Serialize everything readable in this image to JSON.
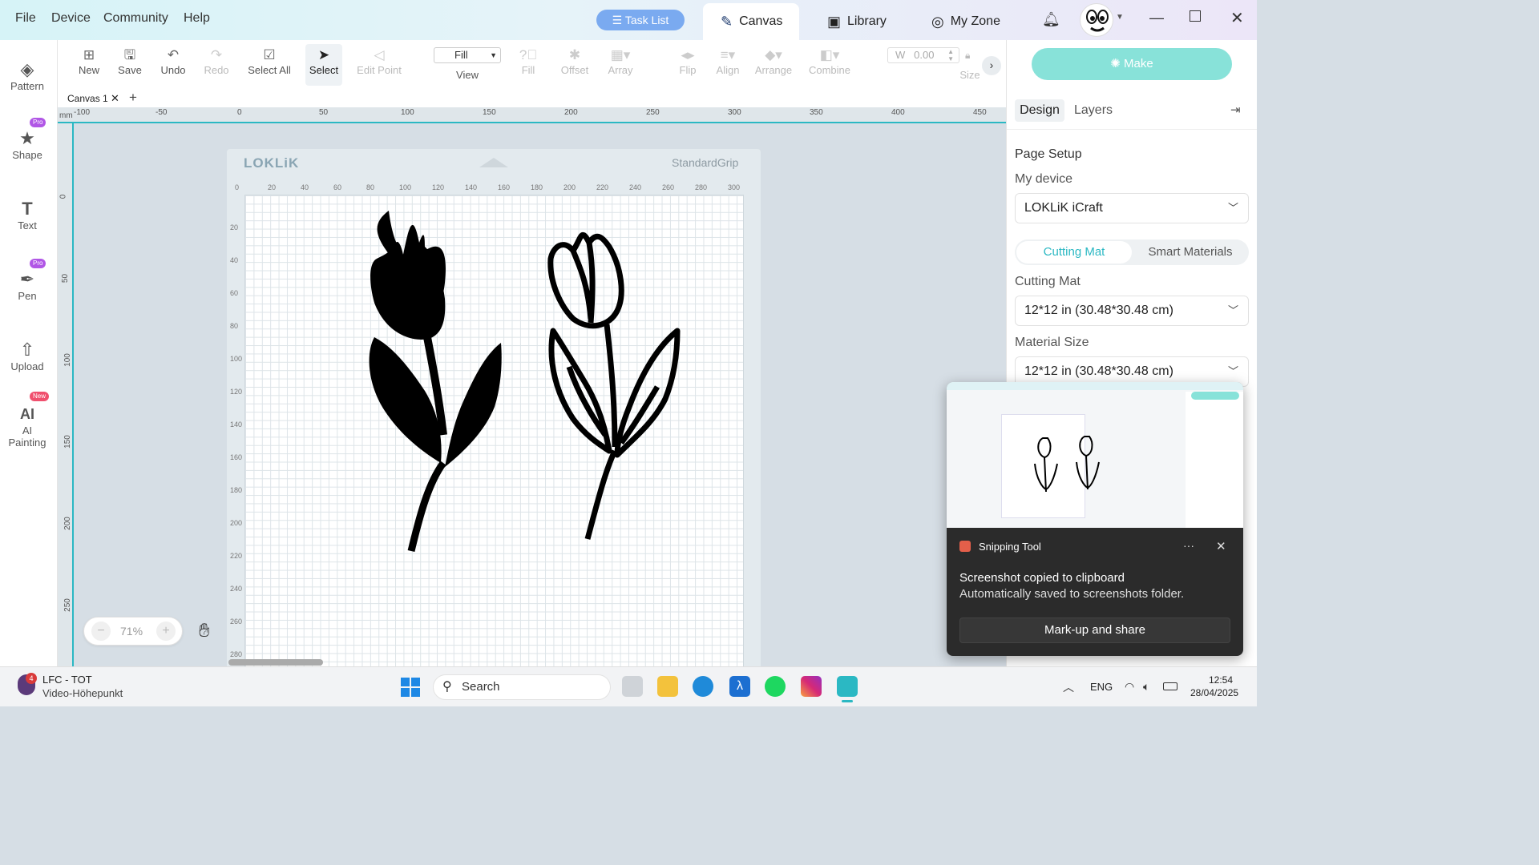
{
  "menu": {
    "file": "File",
    "device": "Device",
    "community": "Community",
    "help": "Help"
  },
  "header": {
    "task_list": "Task List",
    "tabs": {
      "canvas": "Canvas",
      "library": "Library",
      "my_zone": "My Zone"
    }
  },
  "toolbar": {
    "new": "New",
    "save": "Save",
    "undo": "Undo",
    "redo": "Redo",
    "select_all": "Select All",
    "select": "Select",
    "edit_point": "Edit Point",
    "view_value": "Fill",
    "view": "View",
    "fill": "Fill",
    "offset": "Offset",
    "array": "Array",
    "flip": "Flip",
    "align": "Align",
    "arrange": "Arrange",
    "combine": "Combine",
    "width_label": "W",
    "width_value": "0.00",
    "size": "Size"
  },
  "left_sidebar": {
    "pattern": "Pattern",
    "shape": "Shape",
    "text": "Text",
    "pen": "Pen",
    "upload": "Upload",
    "ai_painting_1": "AI",
    "ai_painting_2": "Painting",
    "pro_badge": "Pro",
    "new_badge": "New"
  },
  "canvas_tabs": {
    "tab1": "Canvas 1",
    "add": "+"
  },
  "ruler": {
    "unit": "mm",
    "h_labels": [
      "-100",
      "-50",
      "0",
      "50",
      "100",
      "150",
      "200",
      "250",
      "300",
      "350",
      "400",
      "450"
    ],
    "v_labels": [
      "0",
      "50",
      "100",
      "150",
      "200",
      "250"
    ]
  },
  "mat": {
    "brand": "LOKLiK",
    "type": "StandardGrip",
    "h_labels": [
      "0",
      "20",
      "40",
      "60",
      "80",
      "100",
      "120",
      "140",
      "160",
      "180",
      "200",
      "220",
      "240",
      "260",
      "280",
      "300"
    ],
    "v_labels": [
      "20",
      "40",
      "60",
      "80",
      "100",
      "120",
      "140",
      "160",
      "180",
      "200",
      "220",
      "240",
      "260",
      "280"
    ]
  },
  "zoom": {
    "minus": "−",
    "value": "71%",
    "plus": "+"
  },
  "right_panel": {
    "make": "Make",
    "tab_design": "Design",
    "tab_layers": "Layers",
    "page_setup": "Page Setup",
    "my_device": "My device",
    "device_value": "LOKLiK iCraft",
    "seg_cutting_mat": "Cutting Mat",
    "seg_smart_materials": "Smart Materials",
    "cutting_mat_label": "Cutting Mat",
    "cutting_mat_value": "12*12 in (30.48*30.48 cm)",
    "material_size_label": "Material Size",
    "material_size_value": "12*12 in (30.48*30.48 cm)"
  },
  "snip": {
    "app": "Snipping Tool",
    "more": "···",
    "title": "Screenshot copied to clipboard",
    "subtitle": "Automatically saved to screenshots folder.",
    "button": "Mark-up and share"
  },
  "taskbar": {
    "notif_count": "4",
    "media_title": "LFC - TOT",
    "media_subtitle": "Video-Höhepunkt",
    "search": "Search",
    "lang": "ENG",
    "time": "12:54",
    "date": "28/04/2025"
  },
  "colors": {
    "accent": "#2bb8c3",
    "make": "#88e2d9",
    "task_list": "#7aaaf0",
    "pro_badge": "#b157e6",
    "new_badge": "#f0506e"
  }
}
